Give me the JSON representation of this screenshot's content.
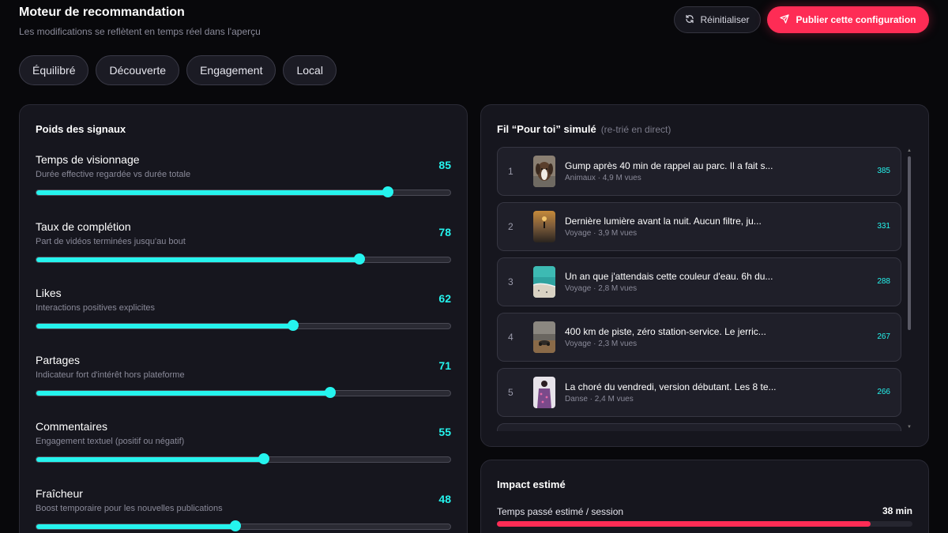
{
  "header": {
    "title": "Moteur de recommandation",
    "subtitle": "Les modifications se reflètent en temps réel dans l'aperçu"
  },
  "actions": {
    "reset_label": "Réinitialiser",
    "reset_icon": "refresh-icon",
    "publish_label": "Publier cette configuration",
    "publish_icon": "send-icon"
  },
  "presets": [
    "Équilibré",
    "Découverte",
    "Engagement",
    "Local"
  ],
  "signals_panel": {
    "title": "Poids des signaux",
    "signals": [
      {
        "name": "Temps de visionnage",
        "desc": "Durée effective regardée vs durée totale",
        "value": 85
      },
      {
        "name": "Taux de complétion",
        "desc": "Part de vidéos terminées jusqu'au bout",
        "value": 78
      },
      {
        "name": "Likes",
        "desc": "Interactions positives explicites",
        "value": 62
      },
      {
        "name": "Partages",
        "desc": "Indicateur fort d'intérêt hors plateforme",
        "value": 71
      },
      {
        "name": "Commentaires",
        "desc": "Engagement textuel (positif ou négatif)",
        "value": 55
      },
      {
        "name": "Fraîcheur",
        "desc": "Boost temporaire pour les nouvelles publications",
        "value": 48
      }
    ]
  },
  "feed_panel": {
    "title": "Fil “Pour toi” simulé",
    "hint": "(re-trié en direct)",
    "items": [
      {
        "rank": "1",
        "title": "Gump après 40 min de rappel au parc. Il a fait s...",
        "meta": "Animaux · 4,9 M vues",
        "score": "385",
        "thumb": "dog-photo"
      },
      {
        "rank": "2",
        "title": "Dernière lumière avant la nuit. Aucun filtre, ju...",
        "meta": "Voyage · 3,9 M vues",
        "score": "331",
        "thumb": "sunset-photo"
      },
      {
        "rank": "3",
        "title": "Un an que j'attendais cette couleur d'eau. 6h du...",
        "meta": "Voyage · 2,8 M vues",
        "score": "288",
        "thumb": "beach-photo"
      },
      {
        "rank": "4",
        "title": "400 km de piste, zéro station-service. Le jerric...",
        "meta": "Voyage · 2,3 M vues",
        "score": "267",
        "thumb": "desert-photo"
      },
      {
        "rank": "5",
        "title": "La choré du vendredi, version débutant. Les 8 te...",
        "meta": "Danse · 2,4 M vues",
        "score": "266",
        "thumb": "dancer-photo"
      }
    ]
  },
  "impact_panel": {
    "title": "Impact estimé",
    "metric_label": "Temps passé estimé / session",
    "metric_value": "38 min",
    "metric_fraction": 0.9
  },
  "colors": {
    "accent_cyan": "#25f4ee",
    "accent_red": "#fe2c55",
    "background": "#08080b",
    "panel": "#16161e"
  }
}
